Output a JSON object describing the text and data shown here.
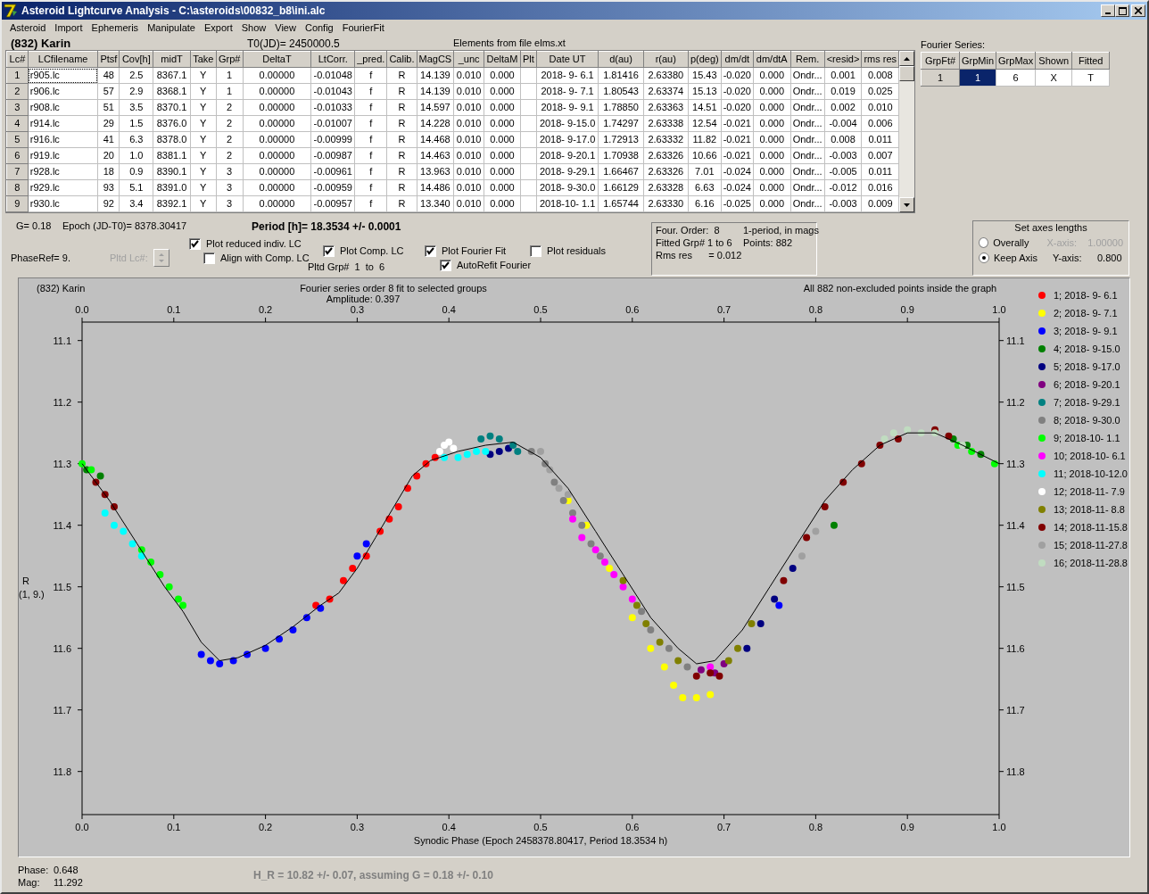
{
  "window": {
    "title": "Asteroid Lightcurve Analysis - C:\\asteroids\\00832_b8\\ini.alc"
  },
  "menu": [
    "Asteroid",
    "Import",
    "Ephemeris",
    "Manipulate",
    "Export",
    "Show",
    "View",
    "Config",
    "FourierFit"
  ],
  "header": {
    "object": "(832) Karin",
    "t0": "T0(JD)= 2450000.5",
    "elements": "Elements from file elms.xt"
  },
  "table": {
    "columns": [
      "Lc#",
      "LCfilename",
      "Ptsf",
      "Cov[h]",
      "midT",
      "Take",
      "Grp#",
      "DeltaT",
      "LtCorr.",
      "_pred.",
      "Calib.",
      "MagCS",
      "_unc",
      "DeltaM",
      "Plt",
      "Date UT",
      "d(au)",
      "r(au)",
      "p(deg)",
      "dm/dt",
      "dm/dtA",
      "Rem.",
      "<resid>",
      "rms res"
    ],
    "rows": [
      {
        "focused": true,
        "cells": [
          "1",
          "r905.lc",
          "48",
          "2.5",
          "8367.1",
          "Y",
          "1",
          "0.00000",
          "-0.01048",
          "f",
          "R",
          "14.139",
          "0.010",
          "0.000",
          "",
          "2018- 9- 6.1",
          "1.81416",
          "2.63380",
          "15.43",
          "-0.020",
          "0.000",
          "Ondr...",
          "0.001",
          "0.008"
        ]
      },
      {
        "focused": false,
        "cells": [
          "2",
          "r906.lc",
          "57",
          "2.9",
          "8368.1",
          "Y",
          "1",
          "0.00000",
          "-0.01043",
          "f",
          "R",
          "14.139",
          "0.010",
          "0.000",
          "",
          "2018- 9- 7.1",
          "1.80543",
          "2.63374",
          "15.13",
          "-0.020",
          "0.000",
          "Ondr...",
          "0.019",
          "0.025"
        ]
      },
      {
        "focused": false,
        "cells": [
          "3",
          "r908.lc",
          "51",
          "3.5",
          "8370.1",
          "Y",
          "2",
          "0.00000",
          "-0.01033",
          "f",
          "R",
          "14.597",
          "0.010",
          "0.000",
          "",
          "2018- 9- 9.1",
          "1.78850",
          "2.63363",
          "14.51",
          "-0.020",
          "0.000",
          "Ondr...",
          "0.002",
          "0.010"
        ]
      },
      {
        "focused": false,
        "cells": [
          "4",
          "r914.lc",
          "29",
          "1.5",
          "8376.0",
          "Y",
          "2",
          "0.00000",
          "-0.01007",
          "f",
          "R",
          "14.228",
          "0.010",
          "0.000",
          "",
          "2018- 9-15.0",
          "1.74297",
          "2.63338",
          "12.54",
          "-0.021",
          "0.000",
          "Ondr...",
          "-0.004",
          "0.006"
        ]
      },
      {
        "focused": false,
        "cells": [
          "5",
          "r916.lc",
          "41",
          "6.3",
          "8378.0",
          "Y",
          "2",
          "0.00000",
          "-0.00999",
          "f",
          "R",
          "14.468",
          "0.010",
          "0.000",
          "",
          "2018- 9-17.0",
          "1.72913",
          "2.63332",
          "11.82",
          "-0.021",
          "0.000",
          "Ondr...",
          "0.008",
          "0.011"
        ]
      },
      {
        "focused": false,
        "cells": [
          "6",
          "r919.lc",
          "20",
          "1.0",
          "8381.1",
          "Y",
          "2",
          "0.00000",
          "-0.00987",
          "f",
          "R",
          "14.463",
          "0.010",
          "0.000",
          "",
          "2018- 9-20.1",
          "1.70938",
          "2.63326",
          "10.66",
          "-0.021",
          "0.000",
          "Ondr...",
          "-0.003",
          "0.007"
        ]
      },
      {
        "focused": false,
        "cells": [
          "7",
          "r928.lc",
          "18",
          "0.9",
          "8390.1",
          "Y",
          "3",
          "0.00000",
          "-0.00961",
          "f",
          "R",
          "13.963",
          "0.010",
          "0.000",
          "",
          "2018- 9-29.1",
          "1.66467",
          "2.63326",
          "7.01",
          "-0.024",
          "0.000",
          "Ondr...",
          "-0.005",
          "0.011"
        ]
      },
      {
        "focused": false,
        "cells": [
          "8",
          "r929.lc",
          "93",
          "5.1",
          "8391.0",
          "Y",
          "3",
          "0.00000",
          "-0.00959",
          "f",
          "R",
          "14.486",
          "0.010",
          "0.000",
          "",
          "2018- 9-30.0",
          "1.66129",
          "2.63328",
          "6.63",
          "-0.024",
          "0.000",
          "Ondr...",
          "-0.012",
          "0.016"
        ]
      },
      {
        "focused": false,
        "cells": [
          "9",
          "r930.lc",
          "92",
          "3.4",
          "8392.1",
          "Y",
          "3",
          "0.00000",
          "-0.00957",
          "f",
          "R",
          "13.340",
          "0.010",
          "0.000",
          "",
          "2018-10- 1.1",
          "1.65744",
          "2.63330",
          "6.16",
          "-0.025",
          "0.000",
          "Ondr...",
          "-0.003",
          "0.009"
        ]
      }
    ]
  },
  "fourier_series": {
    "title": "Fourier Series:",
    "columns": [
      "GrpFt#",
      "GrpMin",
      "GrpMax",
      "Shown",
      "Fitted"
    ],
    "rows": [
      {
        "cells": [
          {
            "text": "1",
            "selected": false
          },
          {
            "text": "1",
            "selected": true
          },
          {
            "text": "6",
            "selected": false
          },
          {
            "text": "X",
            "selected": false
          },
          {
            "text": "T",
            "selected": false
          }
        ]
      }
    ]
  },
  "fit": {
    "g": "G= 0.18",
    "epoch": "Epoch (JD-T0)= 8378.30417",
    "period": "Period [h]= 18.3534 +/- 0.0001",
    "phase_ref": "PhaseRef= 9.",
    "pltd_lc": {
      "label": "Pltd Lc#:",
      "disabled": true
    },
    "pltd_grp": "Pltd Grp#  1  to  6"
  },
  "checkboxes": [
    {
      "label": "Plot reduced indiv. LC",
      "checked": true
    },
    {
      "label": "Align with Comp. LC",
      "checked": false
    },
    {
      "label": "Plot Comp. LC",
      "checked": true
    },
    {
      "label": "Plot Fourier Fit",
      "checked": true
    },
    {
      "label": "AutoRefit Fourier",
      "checked": true
    },
    {
      "label": "Plot residuals",
      "checked": false
    }
  ],
  "summary": [
    "Four. Order:  8",
    "1-period, in mags",
    "Fitted Grp# 1 to 6",
    "Points: 882",
    "Rms res      = 0.012"
  ],
  "axes": {
    "title": "Set axes lengths",
    "options": [
      {
        "label": "Overally",
        "selected": false,
        "field_label": "X-axis:",
        "value": "1.00000",
        "disabled": true
      },
      {
        "label": "Keep Axis",
        "selected": true,
        "field_label": "Y-axis:",
        "value": "0.800",
        "disabled": false
      }
    ]
  },
  "plot": {
    "object": "(832) Karin",
    "title": "Fourier series order 8 fit to selected groups",
    "amplitude": "Amplitude: 0.397",
    "note": "All 882 non-excluded points inside the graph",
    "ylabel_sub": "(1, 9.)",
    "right_ticks": [
      "11.1",
      "11.2",
      "11.3",
      "11.4",
      "11.5",
      "11.6",
      "11.7",
      "11.8"
    ],
    "chart_data": {
      "type": "scatter",
      "xlabel": "Synodic Phase (Epoch 2458378.80417, Period 18.3534 h)",
      "ylabel": "R",
      "legend": "right",
      "xlim": [
        0,
        1
      ],
      "ylim": [
        11.87,
        11.07
      ],
      "xticks": [
        {
          "value": 0,
          "label": "0.0"
        },
        {
          "value": 0.1,
          "label": "0.1"
        },
        {
          "value": 0.2,
          "label": "0.2"
        },
        {
          "value": 0.3,
          "label": "0.3"
        },
        {
          "value": 0.4,
          "label": "0.4"
        },
        {
          "value": 0.5,
          "label": "0.5"
        },
        {
          "value": 0.6,
          "label": "0.6"
        },
        {
          "value": 0.7,
          "label": "0.7"
        },
        {
          "value": 0.8,
          "label": "0.8"
        },
        {
          "value": 0.9,
          "label": "0.9"
        },
        {
          "value": 1,
          "label": "1.0"
        }
      ],
      "yticks": [
        {
          "value": 11.1,
          "label": "11.1"
        },
        {
          "value": 11.2,
          "label": "11.2"
        },
        {
          "value": 11.3,
          "label": "11.3"
        },
        {
          "value": 11.4,
          "label": "11.4"
        },
        {
          "value": 11.5,
          "label": "11.5"
        },
        {
          "value": 11.6,
          "label": "11.6"
        },
        {
          "value": 11.7,
          "label": "11.7"
        },
        {
          "value": 11.8,
          "label": "11.8"
        }
      ],
      "series": [
        {
          "name": "1; 2018- 9- 6.1",
          "color": "#ff0000",
          "x": [
            0.255,
            0.27,
            0.285,
            0.295,
            0.31,
            0.325,
            0.335,
            0.345,
            0.355,
            0.365,
            0.375,
            0.385
          ],
          "values": [
            11.53,
            11.52,
            11.49,
            11.47,
            11.45,
            11.41,
            11.39,
            11.37,
            11.34,
            11.32,
            11.3,
            11.29
          ]
        },
        {
          "name": "2; 2018- 9- 7.1",
          "color": "#ffff00",
          "x": [
            0.53,
            0.55,
            0.575,
            0.6,
            0.62,
            0.635,
            0.645,
            0.655,
            0.67,
            0.685
          ],
          "values": [
            11.36,
            11.4,
            11.47,
            11.55,
            11.6,
            11.63,
            11.66,
            11.68,
            11.68,
            11.675
          ]
        },
        {
          "name": "3; 2018- 9- 9.1",
          "color": "#0000ff",
          "x": [
            0.13,
            0.14,
            0.15,
            0.165,
            0.18,
            0.2,
            0.215,
            0.23,
            0.245,
            0.26,
            0.3,
            0.31,
            0.76
          ],
          "values": [
            11.61,
            11.62,
            11.625,
            11.62,
            11.61,
            11.6,
            11.585,
            11.57,
            11.55,
            11.535,
            11.45,
            11.43,
            11.53
          ]
        },
        {
          "name": "4; 2018- 9-15.0",
          "color": "#008000",
          "x": [
            0.005,
            0.02,
            0.82,
            0.95,
            0.965,
            0.98
          ],
          "values": [
            11.31,
            11.32,
            11.4,
            11.26,
            11.27,
            11.285
          ]
        },
        {
          "name": "5; 2018- 9-17.0",
          "color": "#000080",
          "x": [
            0.445,
            0.455,
            0.465,
            0.725,
            0.74,
            0.755,
            0.775
          ],
          "values": [
            11.285,
            11.28,
            11.275,
            11.6,
            11.56,
            11.52,
            11.47
          ]
        },
        {
          "name": "6; 2018- 9-20.1",
          "color": "#800080",
          "x": [
            0.675,
            0.69,
            0.7
          ],
          "values": [
            11.635,
            11.64,
            11.625
          ]
        },
        {
          "name": "7; 2018- 9-29.1",
          "color": "#008080",
          "x": [
            0.435,
            0.445,
            0.455,
            0.47,
            0.475
          ],
          "values": [
            11.26,
            11.255,
            11.26,
            11.27,
            11.28
          ]
        },
        {
          "name": "8; 2018- 9-30.0",
          "color": "#808080",
          "x": [
            0.49,
            0.505,
            0.515,
            0.525,
            0.535,
            0.545,
            0.555,
            0.565,
            0.61,
            0.62,
            0.64,
            0.66
          ],
          "values": [
            11.28,
            11.3,
            11.33,
            11.36,
            11.38,
            11.4,
            11.43,
            11.45,
            11.54,
            11.57,
            11.6,
            11.63
          ]
        },
        {
          "name": "9; 2018-10- 1.1",
          "color": "#00ff00",
          "x": [
            0.0,
            0.01,
            0.065,
            0.075,
            0.085,
            0.095,
            0.105,
            0.11,
            0.955,
            0.97,
            0.995
          ],
          "values": [
            11.3,
            11.31,
            11.44,
            11.46,
            11.48,
            11.5,
            11.52,
            11.53,
            11.27,
            11.28,
            11.3
          ]
        },
        {
          "name": "10; 2018-10- 6.1",
          "color": "#ff00ff",
          "x": [
            0.535,
            0.545,
            0.56,
            0.57,
            0.58,
            0.59,
            0.6,
            0.685
          ],
          "values": [
            11.39,
            11.42,
            11.44,
            11.46,
            11.48,
            11.5,
            11.52,
            11.63
          ]
        },
        {
          "name": "11; 2018-10-12.0",
          "color": "#00ffff",
          "x": [
            0.025,
            0.035,
            0.045,
            0.055,
            0.065,
            0.395,
            0.41,
            0.42,
            0.43,
            0.44
          ],
          "values": [
            11.38,
            11.4,
            11.41,
            11.43,
            11.45,
            11.29,
            11.29,
            11.285,
            11.28,
            11.28
          ]
        },
        {
          "name": "12; 2018-11- 7.9",
          "color": "#ffffff",
          "x": [
            0.39,
            0.395,
            0.4,
            0.405
          ],
          "values": [
            11.28,
            11.27,
            11.265,
            11.275
          ]
        },
        {
          "name": "13; 2018-11- 8.8",
          "color": "#808000",
          "x": [
            0.59,
            0.605,
            0.615,
            0.63,
            0.65,
            0.705,
            0.715,
            0.73
          ],
          "values": [
            11.49,
            11.53,
            11.56,
            11.59,
            11.62,
            11.62,
            11.6,
            11.56
          ]
        },
        {
          "name": "14; 2018-11-15.8",
          "color": "#800000",
          "x": [
            0.015,
            0.025,
            0.035,
            0.67,
            0.685,
            0.695,
            0.765,
            0.79,
            0.81,
            0.83,
            0.85,
            0.87,
            0.89,
            0.93,
            0.945
          ],
          "values": [
            11.33,
            11.35,
            11.37,
            11.645,
            11.64,
            11.645,
            11.49,
            11.42,
            11.37,
            11.33,
            11.3,
            11.27,
            11.26,
            11.245,
            11.255
          ]
        },
        {
          "name": "15; 2018-11-27.8",
          "color": "#a0a0a0",
          "x": [
            0.5,
            0.51,
            0.52,
            0.53,
            0.785,
            0.8
          ],
          "values": [
            11.28,
            11.31,
            11.34,
            11.35,
            11.45,
            11.41
          ]
        },
        {
          "name": "16; 2018-11-28.8",
          "color": "#c0dcc0",
          "x": [
            0.875,
            0.885,
            0.9,
            0.915,
            0.93,
            0.96
          ],
          "values": [
            11.26,
            11.25,
            11.245,
            11.25,
            11.25,
            11.27
          ]
        },
        {
          "type": "line",
          "color": "#000000",
          "x": [
            0,
            0.03,
            0.06,
            0.09,
            0.11,
            0.13,
            0.15,
            0.17,
            0.2,
            0.23,
            0.26,
            0.28,
            0.3,
            0.32,
            0.34,
            0.36,
            0.38,
            0.41,
            0.44,
            0.47,
            0.5,
            0.53,
            0.56,
            0.59,
            0.62,
            0.65,
            0.67,
            0.69,
            0.72,
            0.75,
            0.78,
            0.81,
            0.84,
            0.87,
            0.9,
            0.93,
            0.96,
            1
          ],
          "values": [
            11.3,
            11.36,
            11.43,
            11.5,
            11.54,
            11.59,
            11.62,
            11.615,
            11.595,
            11.565,
            11.53,
            11.51,
            11.47,
            11.42,
            11.37,
            11.32,
            11.295,
            11.28,
            11.27,
            11.265,
            11.29,
            11.34,
            11.41,
            11.48,
            11.55,
            11.6,
            11.625,
            11.62,
            11.57,
            11.5,
            11.43,
            11.36,
            11.31,
            11.27,
            11.25,
            11.25,
            11.27,
            11.3
          ]
        }
      ]
    }
  },
  "status": {
    "phase_label": "Phase:",
    "phase": "0.648",
    "mag_label": "Mag:",
    "mag": "11.292",
    "h_value": "H_R = 10.82 +/- 0.07, assuming G = 0.18 +/- 0.10"
  }
}
